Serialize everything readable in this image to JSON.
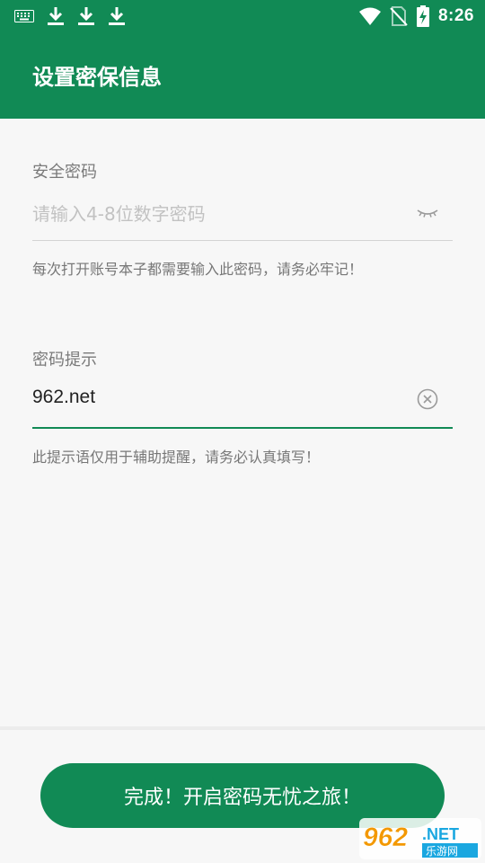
{
  "status_bar": {
    "time": "8:26",
    "icons": [
      "keyboard-icon",
      "download-icon",
      "download-icon",
      "download-icon",
      "wifi-icon",
      "no-sim-icon",
      "battery-charging-icon"
    ]
  },
  "header": {
    "title": "设置密保信息"
  },
  "security_password": {
    "label": "安全密码",
    "placeholder": "请输入4-8位数字密码",
    "helper": "每次打开账号本子都需要输入此密码，请务必牢记！"
  },
  "password_hint": {
    "label": "密码提示",
    "value": "962.net",
    "helper": "此提示语仅用于辅助提醒，请务必认真填写！"
  },
  "done_button": {
    "label": "完成！开启密码无忧之旅！"
  },
  "watermark": {
    "brand": "962",
    "suffix": ".NET",
    "subtitle": "乐游网"
  },
  "colors": {
    "primary": "#118a55",
    "background": "#f7f7f7"
  }
}
